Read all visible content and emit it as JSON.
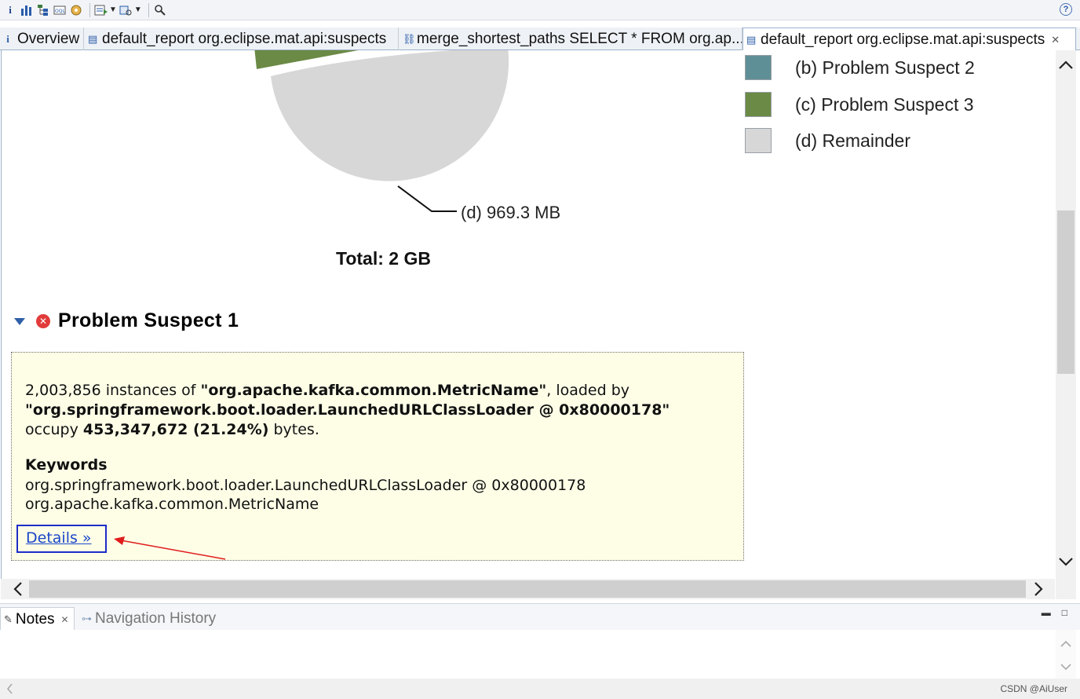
{
  "toolbar": {
    "buttons": [
      "info-icon",
      "histogram-icon",
      "dominator-tree-icon",
      "oql-icon",
      "heap-dump-overview-icon",
      "query-browser-icon",
      "find-object-icon",
      "search-icon"
    ],
    "help_label": "?"
  },
  "tabs": [
    {
      "label": "Overview",
      "icon": "i"
    },
    {
      "label": "default_report  org.eclipse.mat.api:suspects",
      "icon": "▤"
    },
    {
      "label": "merge_shortest_paths  SELECT * FROM org.ap...",
      "icon": "⛓"
    },
    {
      "label": "default_report  org.eclipse.mat.api:suspects",
      "icon": "▤",
      "close": "✕"
    }
  ],
  "chart_data": {
    "type": "pie",
    "title": "Total: 2 GB",
    "legend": [
      {
        "label": "(b)  Problem Suspect 2",
        "color": "#5f8f96"
      },
      {
        "label": "(c)  Problem Suspect 3",
        "color": "#6b8a45"
      },
      {
        "label": "(d)  Remainder",
        "color": "#d7d7d7"
      }
    ],
    "slice_labels": [
      {
        "label": "(d)  969.3 MB"
      }
    ],
    "colors": {
      "remainder": "#d7d7d7",
      "suspect3": "#6b8a45"
    }
  },
  "section": {
    "title": "Problem Suspect 1"
  },
  "suspect": {
    "line1_pre": "2,003,856 instances of ",
    "line1_class": "\"org.apache.kafka.common.MetricName\"",
    "line1_post": ", loaded by",
    "line2_loader": "\"org.springframework.boot.loader.LaunchedURLClassLoader @ 0x80000178\"",
    "line3_pre": "occupy ",
    "line3_bytes": "453,347,672 (21.24%)",
    "line3_post": " bytes.",
    "keywords_title": "Keywords",
    "keywords": [
      "org.springframework.boot.loader.LaunchedURLClassLoader @ 0x80000178",
      "org.apache.kafka.common.MetricName"
    ],
    "details_label": "Details »"
  },
  "bottom": {
    "notes_label": "Notes",
    "nav_history_label": "Navigation History",
    "close_glyph": "✕",
    "minimize_glyph": "▬",
    "maximize_glyph": "□"
  },
  "credit": "CSDN @AiUser"
}
